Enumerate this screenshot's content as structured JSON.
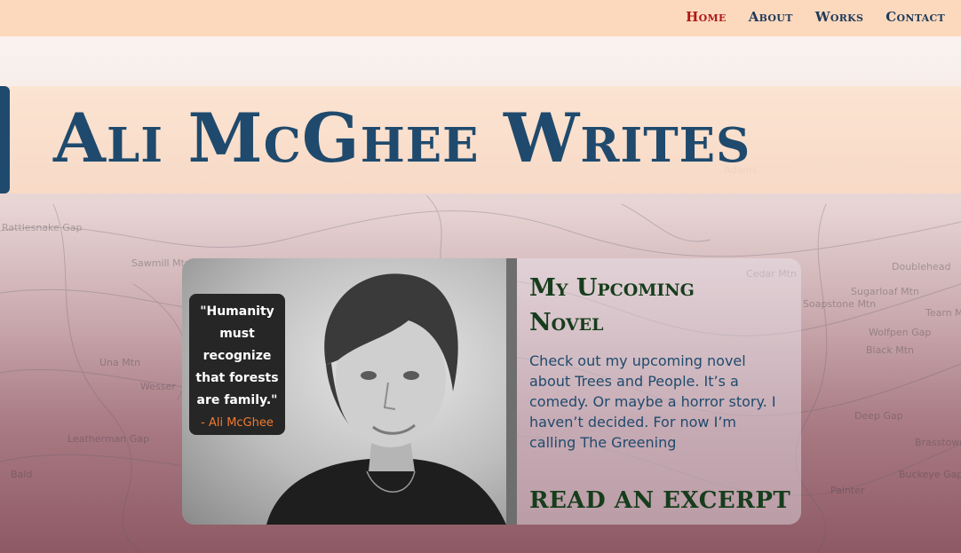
{
  "nav": {
    "items": [
      {
        "label": "Home",
        "active": true
      },
      {
        "label": "About",
        "active": false
      },
      {
        "label": "Works",
        "active": false
      },
      {
        "label": "Contact",
        "active": false
      }
    ]
  },
  "hero": {
    "title": "Ali McGhee Writes"
  },
  "novel_card": {
    "heading": "My Upcoming Novel",
    "description": "Check out my upcoming novel about Trees and People. It’s a comedy. Or maybe a horror story. I haven’t decided. For now I’m calling The Greening",
    "link_label": "READ AN EXCERPT",
    "photo": {
      "quote": "\"Humanity must recognize that forests are family.\"",
      "quote_author": "- Ali McGhee"
    }
  },
  "map_labels": [
    "Rattlesnake Gap",
    "Sawmill Mtn",
    "Una Mtn",
    "Wesser",
    "Leatherman Gap",
    "Bald",
    "Adams",
    "Cedar Mtn",
    "Sugarloaf Mtn",
    "Wolfpen Gap",
    "Black Mtn",
    "Deep Gap",
    "Brasstown",
    "Buckeye Gap",
    "Doublehead",
    "Tearn Mtn",
    "Painter",
    "Soapstone Mtn"
  ],
  "colors": {
    "nav_bg": "#fcd9bd",
    "nav_text": "#1f3a5a",
    "nav_active": "#b01818",
    "title_blue": "#1f4a6d",
    "heading_green": "#163d1c",
    "quote_accent": "#f07b2e"
  }
}
